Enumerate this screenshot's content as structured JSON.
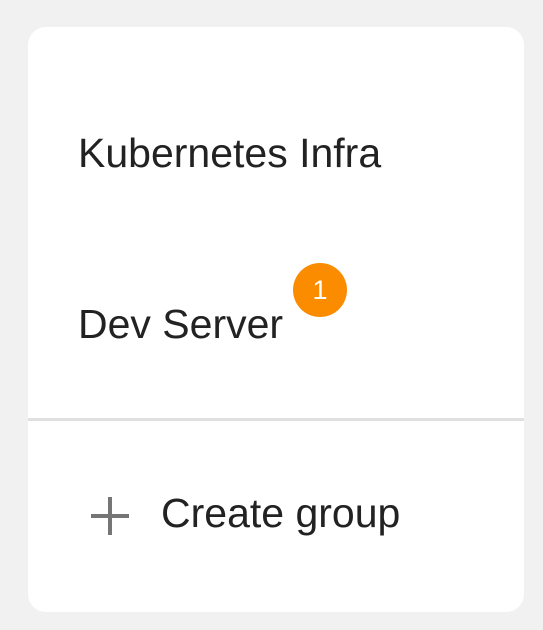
{
  "groups": [
    {
      "label": "Kubernetes Infra",
      "badge": null
    },
    {
      "label": "Dev Server",
      "badge": "1"
    }
  ],
  "actions": {
    "create_group_label": "Create group",
    "create_group_icon": "plus-icon"
  },
  "colors": {
    "background": "#f1f1f1",
    "card": "#ffffff",
    "badge": "#fb8c00",
    "text": "#222222",
    "icon": "#757575",
    "divider": "#e0e0e0"
  }
}
